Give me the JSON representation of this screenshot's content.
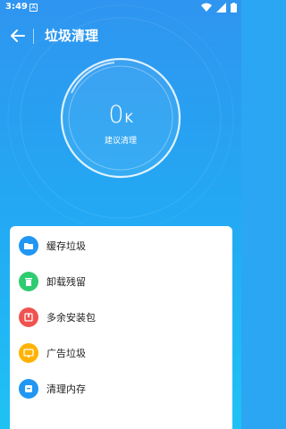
{
  "status_bar": {
    "time": "3:49",
    "notification_glyph": "A",
    "icons": [
      "wifi-icon",
      "signal-icon",
      "battery-icon"
    ]
  },
  "header": {
    "title": "垃圾清理",
    "back_icon": "arrow-left-icon"
  },
  "gauge": {
    "value": "0",
    "unit": "K",
    "label": "建议清理"
  },
  "items": [
    {
      "label": "缓存垃圾",
      "icon": "folder-icon",
      "color": "#2196f3"
    },
    {
      "label": "卸载残留",
      "icon": "trash-icon",
      "color": "#2ecc71"
    },
    {
      "label": "多余安装包",
      "icon": "package-icon",
      "color": "#ef5350"
    },
    {
      "label": "广告垃圾",
      "icon": "ad-icon",
      "color": "#ffb300"
    },
    {
      "label": "清理内存",
      "icon": "memory-icon",
      "color": "#2196f3"
    }
  ],
  "colors": {
    "background_top": "#2f95f0",
    "background_bottom": "#1fc2f4",
    "card": "#ffffff"
  }
}
